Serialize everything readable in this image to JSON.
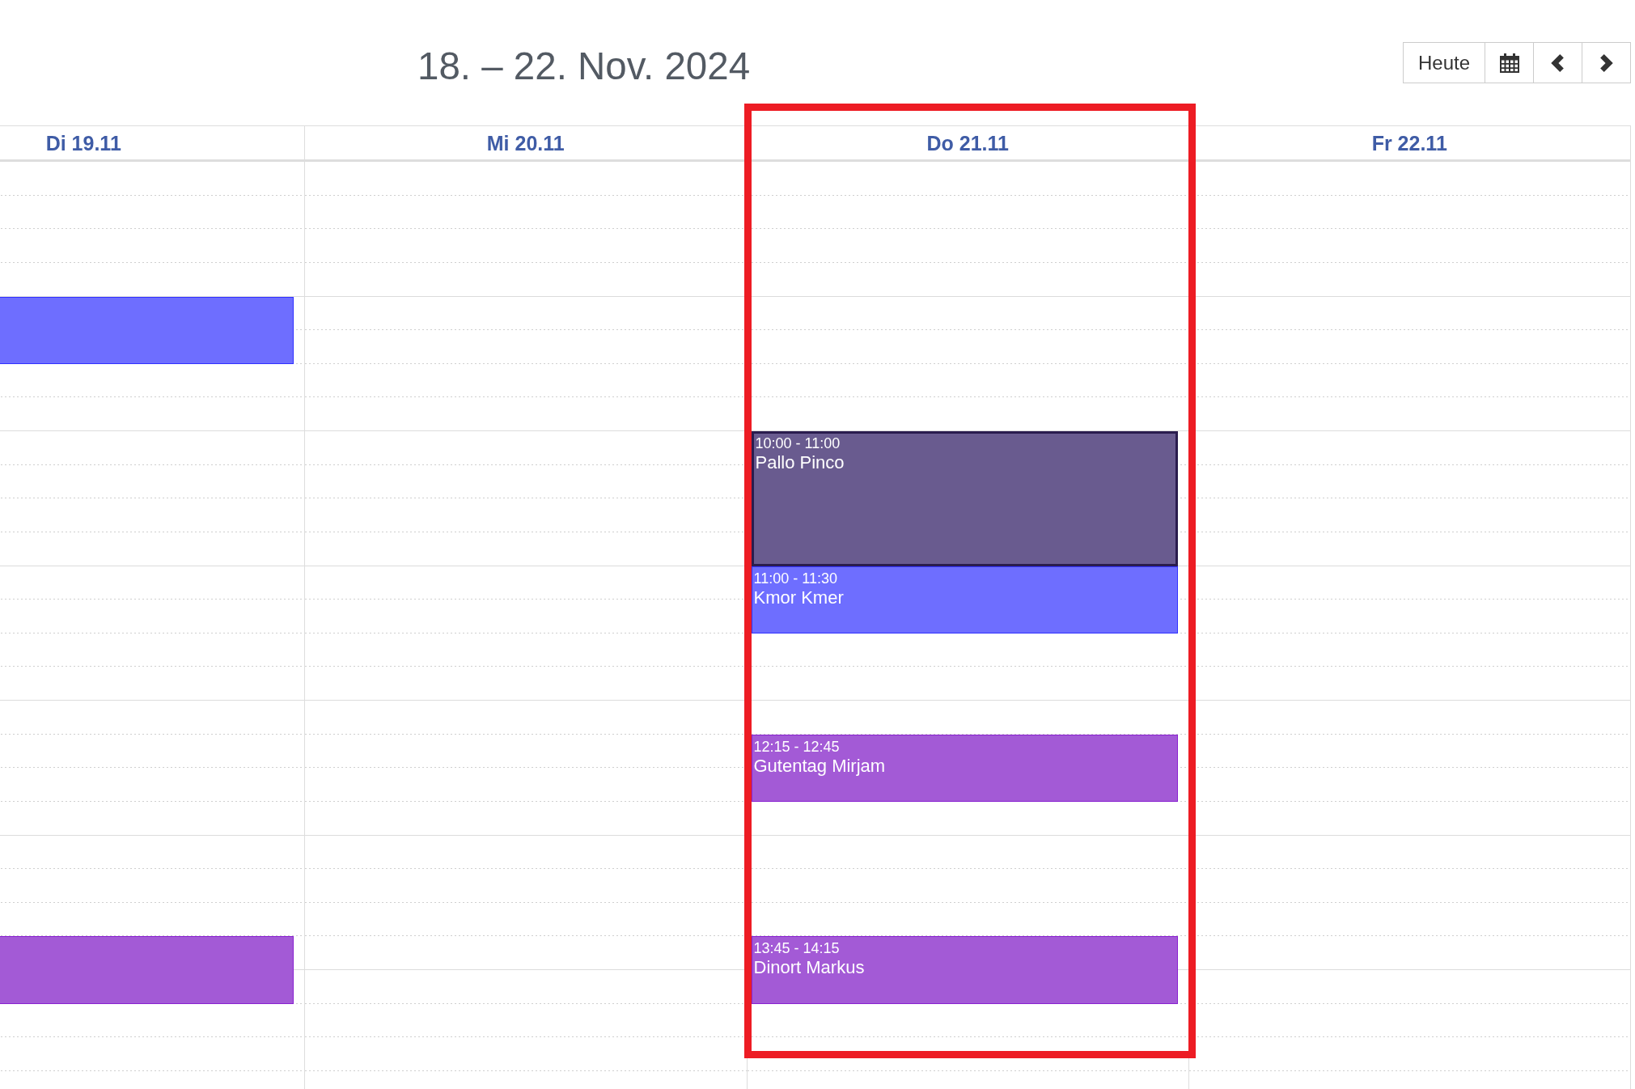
{
  "header": {
    "title": "18. – 22. Nov. 2024"
  },
  "toolbar": {
    "today_button": "Heute"
  },
  "calendar": {
    "days": [
      {
        "label": "Di 19.11",
        "highlighted": false,
        "timeline": [
          {
            "kind": "free"
          },
          {
            "kind": "free"
          },
          {
            "kind": "free"
          },
          {
            "kind": "free"
          },
          {
            "kind": "halfhour",
            "color": "#6e6eff",
            "selected": false
          },
          {
            "kind": "free"
          },
          {
            "kind": "free"
          },
          {
            "kind": "free"
          },
          {
            "kind": "free"
          },
          {
            "kind": "free"
          },
          {
            "kind": "free"
          },
          {
            "kind": "free"
          },
          {
            "kind": "free"
          },
          {
            "kind": "free"
          },
          {
            "kind": "free"
          },
          {
            "kind": "free"
          },
          {
            "kind": "free"
          },
          {
            "kind": "free"
          },
          {
            "kind": "free"
          },
          {
            "kind": "free"
          },
          {
            "kind": "free"
          },
          {
            "kind": "free"
          },
          {
            "kind": "halfhour",
            "color": "#a35ad6",
            "selected": false
          }
        ]
      },
      {
        "label": "Mi 20.11",
        "highlighted": false
      },
      {
        "label": "Do 21.11",
        "highlighted": true,
        "timeline": [
          {
            "kind": "free"
          },
          {
            "kind": "free"
          },
          {
            "kind": "free"
          },
          {
            "kind": "free"
          },
          {
            "kind": "free"
          },
          {
            "kind": "free"
          },
          {
            "kind": "free"
          },
          {
            "kind": "free"
          },
          {
            "kind": "hour",
            "time": "10:00 - 11:00",
            "name": "Pallo Pinco",
            "color": "#695b8f",
            "selected": true
          },
          {
            "kind": "halfhour",
            "time": "11:00 - 11:30",
            "name": "Kmor Kmer",
            "color": "#6e6eff",
            "selected": false
          },
          {
            "kind": "free"
          },
          {
            "kind": "free"
          },
          {
            "kind": "free"
          },
          {
            "kind": "halfhour",
            "time": "12:15 - 12:45",
            "name": "Gutentag Mirjam",
            "color": "#a35ad6",
            "selected": false
          },
          {
            "kind": "free"
          },
          {
            "kind": "free"
          },
          {
            "kind": "free"
          },
          {
            "kind": "free"
          },
          {
            "kind": "halfhour",
            "time": "13:45 - 14:15",
            "name": "Dinort Markus",
            "color": "#a35ad6",
            "selected": false
          }
        ]
      },
      {
        "label": "Fr 22.11",
        "highlighted": false
      }
    ]
  }
}
